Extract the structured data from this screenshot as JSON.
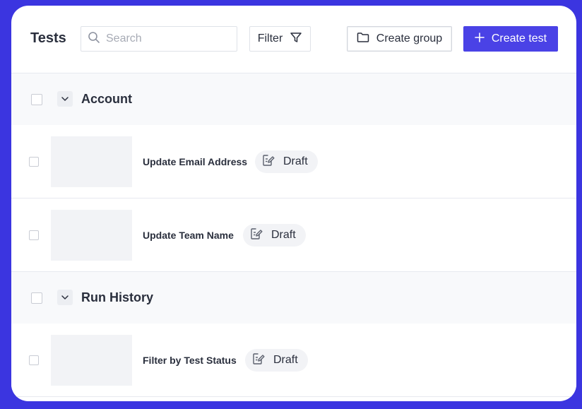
{
  "toolbar": {
    "title": "Tests",
    "search_placeholder": "Search",
    "filter_label": "Filter",
    "create_group_label": "Create group",
    "create_test_label": "Create test"
  },
  "groups": [
    {
      "name": "Account",
      "tests": [
        {
          "name": "Update Email Address",
          "status": "Draft"
        },
        {
          "name": "Update Team Name",
          "status": "Draft"
        }
      ]
    },
    {
      "name": "Run History",
      "tests": [
        {
          "name": "Filter by Test Status",
          "status": "Draft"
        }
      ]
    }
  ],
  "colors": {
    "background": "#3b35e0",
    "primary_button": "#4a42e6",
    "group_row_bg": "#f8f9fb",
    "badge_bg": "#f2f3f6"
  },
  "icons": {
    "search": "search-icon",
    "filter": "filter-icon",
    "folder": "folder-icon",
    "plus": "plus-icon",
    "chevron": "chevron-down-icon",
    "draft": "edit-document-icon"
  }
}
